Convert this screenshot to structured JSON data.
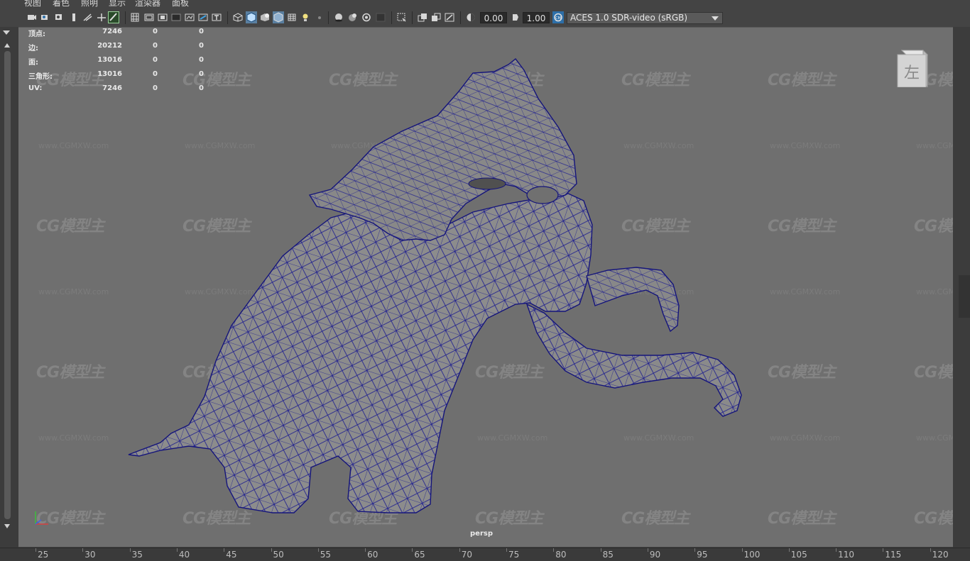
{
  "menu": [
    "视图",
    "着色",
    "照明",
    "显示",
    "渲染器",
    "面板"
  ],
  "toolbar": {
    "exposure": "0.00",
    "gamma": "1.00",
    "color_space": "ACES 1.0 SDR-video (sRGB)",
    "icons": [
      "select-camera-icon",
      "camera-attributes-icon",
      "bookmark-icon",
      "image-plane-icon",
      "grid-icon",
      "film-gate-icon",
      "resolution-gate-icon",
      "gate-mask-icon",
      "field-chart-icon",
      "safe-action-icon",
      "safe-title-icon",
      "wireframe-icon",
      "smooth-shade-icon",
      "default-material-icon",
      "wireframe-on-shaded-icon",
      "textured-icon",
      "lights-icon",
      "shadows-icon",
      "ambient-occlusion-icon",
      "motion-blur-icon",
      "anti-aliasing-icon",
      "isolate-select-icon",
      "xray-icon",
      "xray-joints-icon",
      "backface-icon",
      "exposure-icon",
      "gamma-icon",
      "color-management-icon"
    ]
  },
  "hud": {
    "rows": [
      {
        "label": "顶点:",
        "v1": "7246",
        "v2": "0",
        "v3": "0"
      },
      {
        "label": "边:",
        "v1": "20212",
        "v2": "0",
        "v3": "0"
      },
      {
        "label": "面:",
        "v1": "13016",
        "v2": "0",
        "v3": "0"
      },
      {
        "label": "三角形:",
        "v1": "13016",
        "v2": "0",
        "v3": "0"
      },
      {
        "label": "UV:",
        "v1": "7246",
        "v2": "0",
        "v3": "0"
      }
    ]
  },
  "viewport": {
    "camera": "persp",
    "viewcube_label": "左",
    "watermark": "CG模型主",
    "watermark_url": "www.CGMXW.com",
    "mesh_color": "#1a1a8c",
    "model_color": "#8a8a8a"
  },
  "timeline": {
    "ticks": [
      "25",
      "30",
      "35",
      "40",
      "45",
      "50",
      "55",
      "60",
      "65",
      "70",
      "75",
      "80",
      "85",
      "90",
      "95",
      "100",
      "105",
      "110",
      "115",
      "120"
    ]
  }
}
